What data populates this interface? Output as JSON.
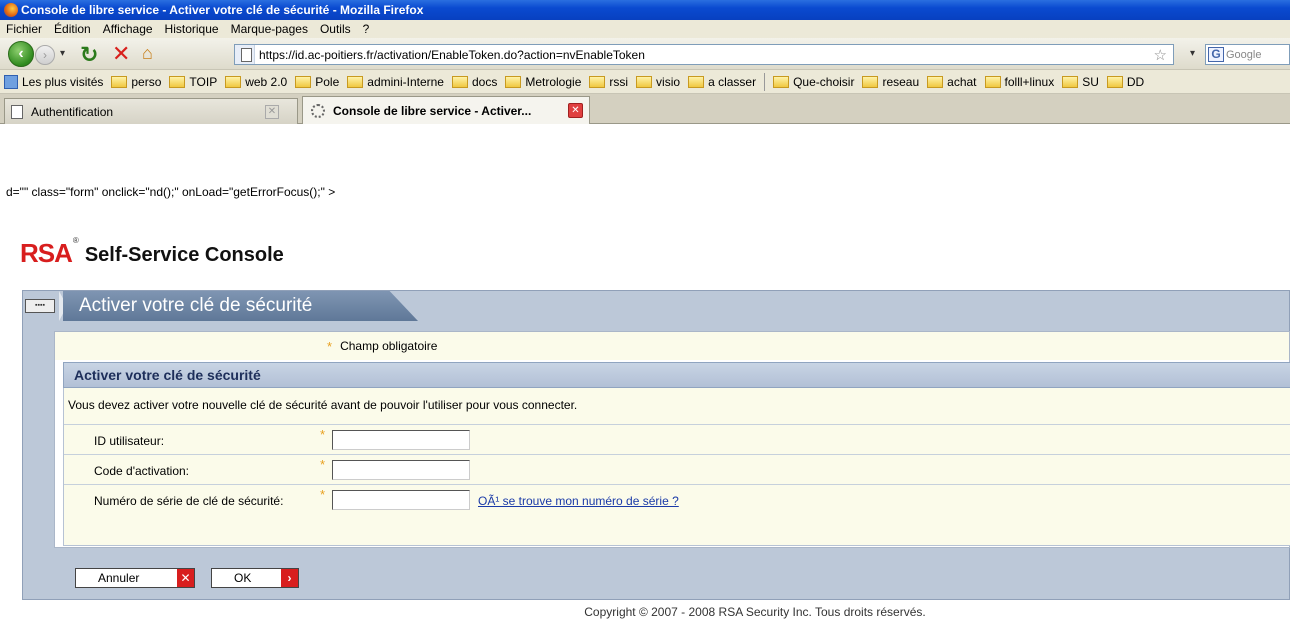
{
  "window": {
    "title": "Console de libre service - Activer votre clé de sécurité - Mozilla Firefox"
  },
  "menu": [
    "Fichier",
    "Édition",
    "Affichage",
    "Historique",
    "Marque-pages",
    "Outils",
    "?"
  ],
  "url": "https://id.ac-poitiers.fr/activation/EnableToken.do?action=nvEnableToken",
  "search_placeholder": "Google",
  "bookmarks": [
    "Les plus visités",
    "perso",
    "TOIP",
    "web 2.0",
    "Pole",
    "admini-Interne",
    "docs",
    "Metrologie",
    "rssi",
    "visio",
    "a classer",
    "Que-choisir",
    "reseau",
    "achat",
    "folll+linux",
    "SU",
    "DD"
  ],
  "tabs": [
    {
      "label": "Authentification"
    },
    {
      "label": "Console de libre service - Activer..."
    }
  ],
  "page": {
    "stray_text": "d=\"\" class=\"form\" onclick=\"nd();\" onLoad=\"getErrorFocus();\" >",
    "brand": "RSA",
    "brand_reg": "®",
    "console_title": "Self-Service Console",
    "section_title": "Activer votre clé de sécurité",
    "required_note": "Champ obligatoire",
    "panel_header": "Activer votre clé de sécurité",
    "description": "Vous devez activer votre nouvelle clé de sécurité avant de pouvoir l'utiliser pour vous connecter.",
    "fields": [
      {
        "label": "ID utilisateur:",
        "value": ""
      },
      {
        "label": "Code d'activation:",
        "value": ""
      },
      {
        "label": "Numéro de série de clé de sécurité:",
        "value": "",
        "link": "OÃ¹ se trouve mon numéro de série ?"
      }
    ],
    "buttons": {
      "cancel": "Annuler",
      "ok": "OK"
    },
    "copyright": "Copyright © 2007 - 2008 RSA Security Inc. Tous droits réservés."
  }
}
